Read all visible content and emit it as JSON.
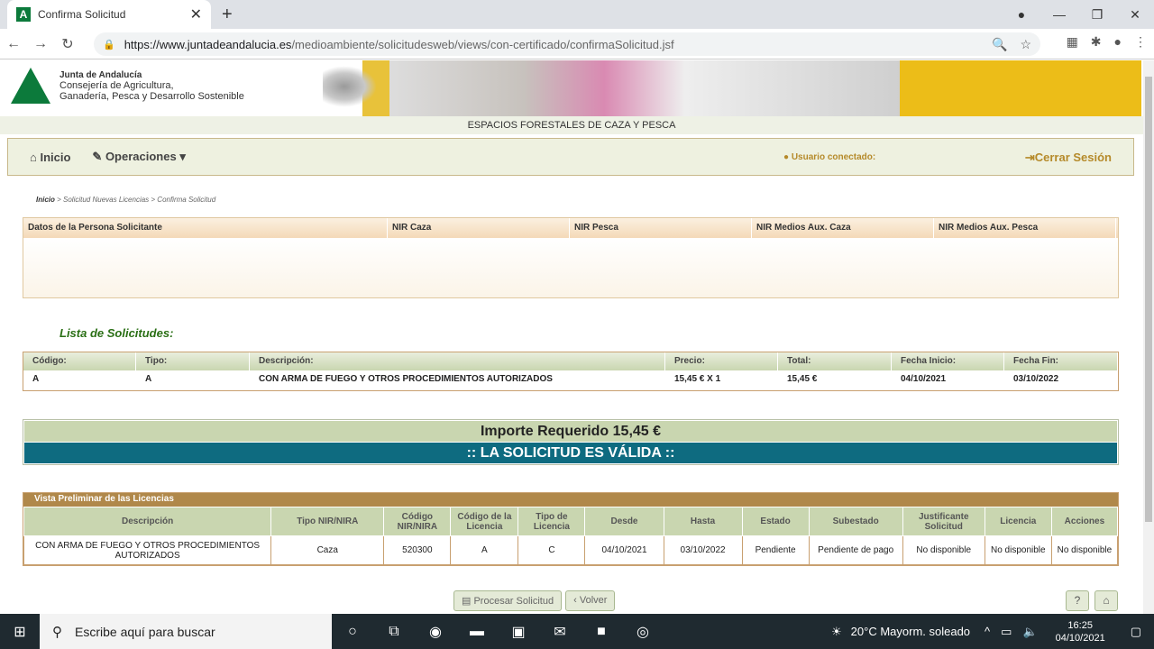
{
  "browser": {
    "tab_title": "Confirma Solicitud",
    "url_domain": "https://www.juntadeandalucia.es",
    "url_path": "/medioambiente/solicitudesweb/views/con-certificado/confirmaSolicitud.jsf"
  },
  "banner": {
    "org": "Junta de Andalucía",
    "dept_line1": "Consejería de Agricultura,",
    "dept_line2": "Ganadería, Pesca y Desarrollo Sostenible",
    "subtitle": "ESPACIOS FORESTALES DE CAZA Y PESCA"
  },
  "nav": {
    "inicio": "Inicio",
    "operaciones": "Operaciones",
    "usuario": "Usuario conectado:",
    "cerrar": "Cerrar Sesión"
  },
  "breadcrumb": {
    "home": "Inicio",
    "rest": " > Solicitud Nuevas Licencias > Confirma Solicitud"
  },
  "persona": {
    "headers": [
      "Datos de la Persona Solicitante",
      "NIR Caza",
      "NIR Pesca",
      "NIR Medios Aux. Caza",
      "NIR Medios Aux. Pesca"
    ]
  },
  "lista": {
    "title": "Lista de Solicitudes:",
    "headers": [
      "Código:",
      "Tipo:",
      "Descripción:",
      "Precio:",
      "Total:",
      "Fecha Inicio:",
      "Fecha Fin:"
    ],
    "row": [
      "A",
      "A",
      "CON ARMA DE FUEGO Y OTROS PROCEDIMIENTOS AUTORIZADOS",
      "15,45 € X 1",
      "15,45 €",
      "04/10/2021",
      "03/10/2022"
    ]
  },
  "importe": {
    "amount": "Importe Requerido 15,45 €",
    "status": ":: LA SOLICITUD ES VÁLIDA ::"
  },
  "preliminar": {
    "caption": "Vista Preliminar de las Licencias",
    "headers": [
      "Descripción",
      "Tipo NIR/NIRA",
      "Código NIR/NIRA",
      "Código de la Licencia",
      "Tipo de Licencia",
      "Desde",
      "Hasta",
      "Estado",
      "Subestado",
      "Justificante Solicitud",
      "Licencia",
      "Acciones"
    ],
    "row": [
      "CON ARMA DE FUEGO Y OTROS PROCEDIMIENTOS AUTORIZADOS",
      "Caza",
      "520300",
      "A",
      "C",
      "04/10/2021",
      "03/10/2022",
      "Pendiente",
      "Pendiente de pago",
      "No disponible",
      "No disponible",
      "No disponible"
    ]
  },
  "buttons": {
    "procesar": "Procesar Solicitud",
    "volver": "Volver",
    "help": "?"
  },
  "taskbar": {
    "search": "Escribe aquí para buscar",
    "weather": "20°C  Mayorm. soleado",
    "time": "16:25",
    "date": "04/10/2021"
  }
}
